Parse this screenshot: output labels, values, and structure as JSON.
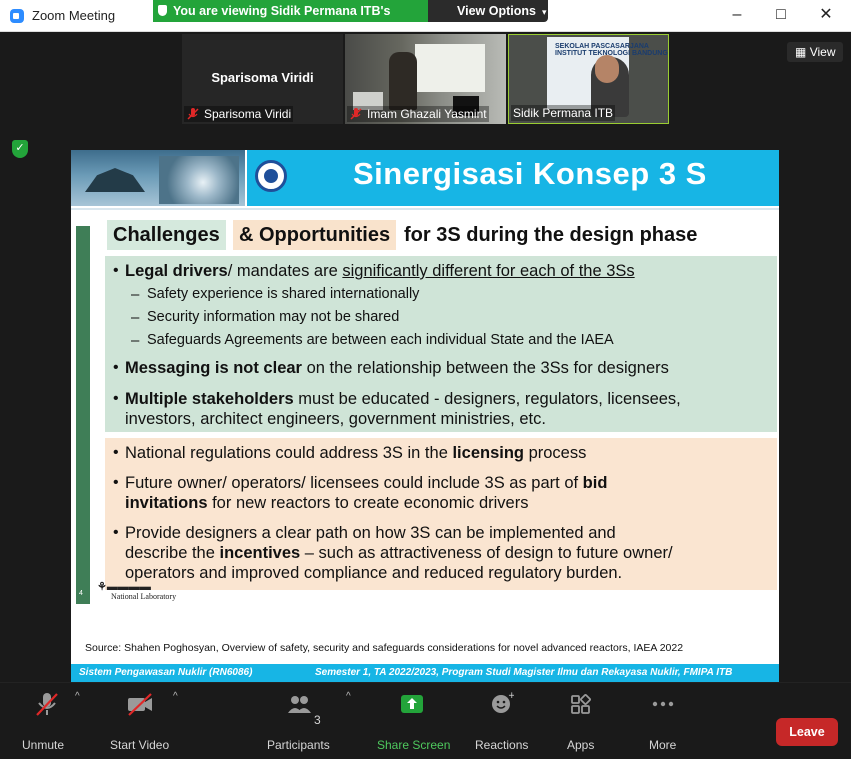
{
  "window": {
    "app_title": "Zoom Meeting",
    "share_banner": "You are viewing Sidik Permana ITB's screen",
    "view_options": "View Options",
    "minimize": "–",
    "maximize": "□",
    "close": "✕"
  },
  "participants_strip": {
    "tiles": [
      {
        "center_name": "Sparisoma Viridi",
        "label": "Sparisoma Viridi"
      },
      {
        "label": "Imam Ghazali Yasmint"
      },
      {
        "label": "Sidik Permana ITB",
        "poster_text": "SEKOLAH PASCASARJANA\nINSTITUT TEKNOLOGI BANDUNG"
      }
    ],
    "view_button": "View"
  },
  "slide": {
    "title": "Sinergisasi Konsep 3 S",
    "heading_part1": "Challenges",
    "heading_part2": "& Opportunities",
    "heading_part3": "for 3S during the design phase",
    "green_box": {
      "b1_bold": "Legal drivers",
      "b1_mid": "/ mandates are ",
      "b1_underline": "significantly different for each of the 3Ss",
      "sub1": "Safety experience is shared internationally",
      "sub2": "Security information may not be shared",
      "sub3": "Safeguards Agreements are between each individual State and the IAEA",
      "b2_bold": "Messaging is not clear",
      "b2_rest": " on the relationship between the 3Ss for designers",
      "b3_bold": "Multiple stakeholders",
      "b3_rest": " must be educated - designers, regulators, licensees,",
      "b3_line2": "investors, architect engineers, government ministries, etc."
    },
    "peach_box": {
      "p1_pre": "National regulations could address 3S in the ",
      "p1_bold": "licensing",
      "p1_post": " process",
      "p2_pre": "Future owner/ operators/ licensees could include 3S as part of ",
      "p2_bold": "bid",
      "p2_l2_bold": "invitations",
      "p2_l2_rest": " for new reactors to create economic drivers",
      "p3_line1": "Provide designers a clear path on how 3S can be implemented and",
      "p3_l2_pre": "describe the ",
      "p3_l2_bold": "incentives",
      "p3_l2_post": " – such as attractiveness of design to future owner/",
      "p3_line3": "operators and improved compliance and reduced regulatory burden."
    },
    "lab_logo_text": "National Laboratory",
    "page_num": "4",
    "source": "Source: Shahen Poghosyan, Overview of safety, security and safeguards considerations for novel advanced reactors, IAEA 2022",
    "footer_left": "Sistem Pengawasan Nuklir (RN6086)",
    "footer_right": "Semester 1, TA 2022/2023, Program Studi Magister Ilmu dan Rekayasa Nuklir, FMIPA ITB"
  },
  "toolbar": {
    "unmute": "Unmute",
    "start_video": "Start Video",
    "participants": "Participants",
    "participants_count": "3",
    "share_screen": "Share Screen",
    "reactions": "Reactions",
    "apps": "Apps",
    "more": "More",
    "leave": "Leave"
  },
  "colors": {
    "share_green": "#23a43a",
    "slide_cyan": "#17b5e5",
    "leave_red": "#c62828",
    "green_box": "#cfe4d7",
    "peach_box": "#fae5d1"
  }
}
